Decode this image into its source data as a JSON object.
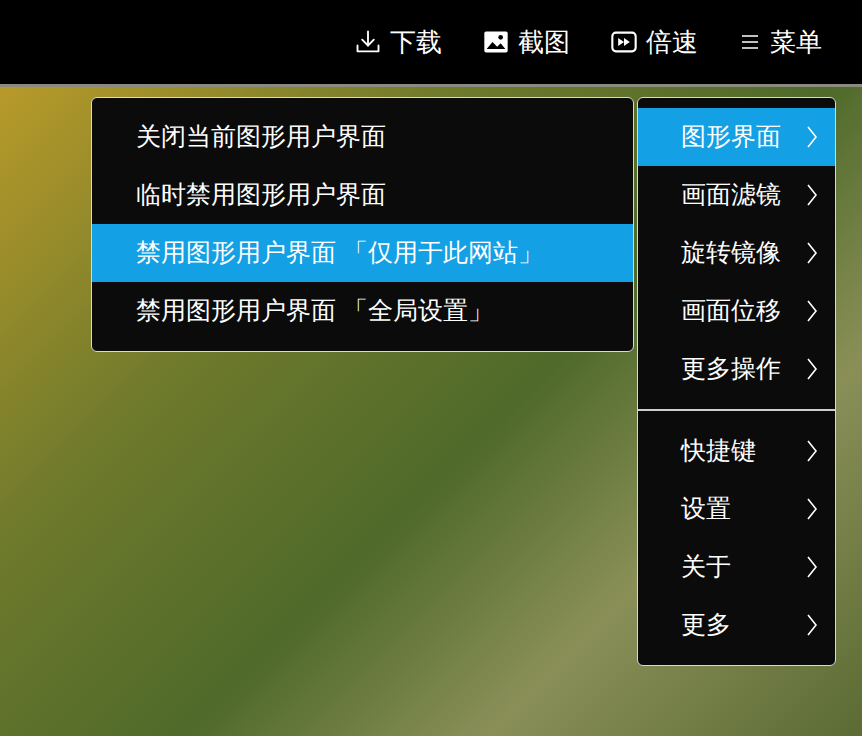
{
  "toolbar": {
    "buttons": [
      {
        "label": "下载"
      },
      {
        "label": "截图"
      },
      {
        "label": "倍速"
      },
      {
        "label": "菜单"
      }
    ]
  },
  "menu": {
    "groups": [
      [
        {
          "label": "图形界面",
          "selected": true,
          "has_submenu": true
        },
        {
          "label": "画面滤镜",
          "selected": false,
          "has_submenu": true
        },
        {
          "label": "旋转镜像",
          "selected": false,
          "has_submenu": true
        },
        {
          "label": "画面位移",
          "selected": false,
          "has_submenu": true
        },
        {
          "label": "更多操作",
          "selected": false,
          "has_submenu": true
        }
      ],
      [
        {
          "label": "快捷键",
          "selected": false,
          "has_submenu": true
        },
        {
          "label": "设置",
          "selected": false,
          "has_submenu": true
        },
        {
          "label": "关于",
          "selected": false,
          "has_submenu": true
        },
        {
          "label": "更多",
          "selected": false,
          "has_submenu": true
        }
      ]
    ]
  },
  "submenu": {
    "items": [
      {
        "label": "关闭当前图形用户界面",
        "selected": false
      },
      {
        "label": "临时禁用图形用户界面",
        "selected": false
      },
      {
        "label": "禁用图形用户界面 「仅用于此网站」",
        "selected": true
      },
      {
        "label": "禁用图形用户界面 「全局设置」",
        "selected": false
      }
    ]
  }
}
